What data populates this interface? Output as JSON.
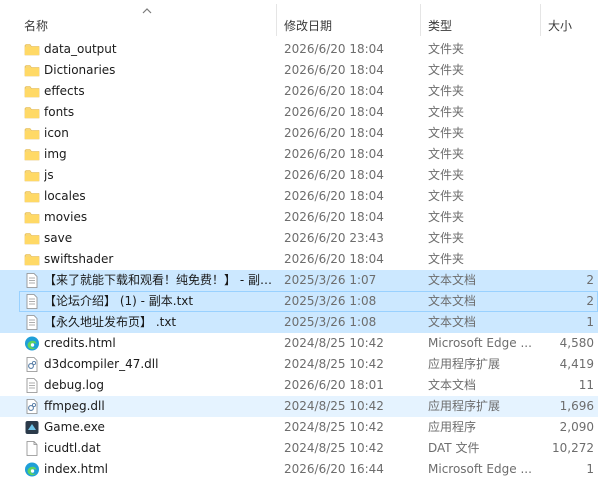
{
  "columns": {
    "name": "名称",
    "date": "修改日期",
    "type": "类型",
    "size": "大小"
  },
  "colors": {
    "selected": "#cce8ff",
    "hover": "#e5f3ff",
    "folder": "#f8d775"
  },
  "rows": [
    {
      "name": "data_output",
      "date": "2026/6/20 18:04",
      "type": "文件夹",
      "size": "",
      "icon": "folder-icon"
    },
    {
      "name": "Dictionaries",
      "date": "2026/6/20 18:04",
      "type": "文件夹",
      "size": "",
      "icon": "folder-icon"
    },
    {
      "name": "effects",
      "date": "2026/6/20 18:04",
      "type": "文件夹",
      "size": "",
      "icon": "folder-icon"
    },
    {
      "name": "fonts",
      "date": "2026/6/20 18:04",
      "type": "文件夹",
      "size": "",
      "icon": "folder-icon"
    },
    {
      "name": "icon",
      "date": "2026/6/20 18:04",
      "type": "文件夹",
      "size": "",
      "icon": "folder-icon"
    },
    {
      "name": "img",
      "date": "2026/6/20 18:04",
      "type": "文件夹",
      "size": "",
      "icon": "folder-icon"
    },
    {
      "name": "js",
      "date": "2026/6/20 18:04",
      "type": "文件夹",
      "size": "",
      "icon": "folder-icon"
    },
    {
      "name": "locales",
      "date": "2026/6/20 18:04",
      "type": "文件夹",
      "size": "",
      "icon": "folder-icon"
    },
    {
      "name": "movies",
      "date": "2026/6/20 18:04",
      "type": "文件夹",
      "size": "",
      "icon": "folder-icon"
    },
    {
      "name": "save",
      "date": "2026/6/20 23:43",
      "type": "文件夹",
      "size": "",
      "icon": "folder-icon"
    },
    {
      "name": "swiftshader",
      "date": "2026/6/20 18:04",
      "type": "文件夹",
      "size": "",
      "icon": "folder-icon"
    },
    {
      "name": "【来了就能下载和观看！纯免费！】 - 副…",
      "date": "2025/3/26 1:07",
      "type": "文本文档",
      "size": "2",
      "icon": "text-file-icon",
      "state": "sel"
    },
    {
      "name": "【论坛介绍】 (1) - 副本.txt",
      "date": "2025/3/26 1:08",
      "type": "文本文档",
      "size": "2",
      "icon": "text-file-icon",
      "state": "sel-focus"
    },
    {
      "name": "【永久地址发布页】 .txt",
      "date": "2025/3/26 1:08",
      "type": "文本文档",
      "size": "1",
      "icon": "text-file-icon",
      "state": "sel"
    },
    {
      "name": "credits.html",
      "date": "2024/8/25 10:42",
      "type": "Microsoft Edge ...",
      "size": "4,580",
      "icon": "edge-icon"
    },
    {
      "name": "d3dcompiler_47.dll",
      "date": "2024/8/25 10:42",
      "type": "应用程序扩展",
      "size": "4,419",
      "icon": "dll-icon"
    },
    {
      "name": "debug.log",
      "date": "2026/6/20 18:01",
      "type": "文本文档",
      "size": "11",
      "icon": "text-file-icon"
    },
    {
      "name": "ffmpeg.dll",
      "date": "2024/8/25 10:42",
      "type": "应用程序扩展",
      "size": "1,696",
      "icon": "dll-icon",
      "state": "hover"
    },
    {
      "name": "Game.exe",
      "date": "2024/8/25 10:42",
      "type": "应用程序",
      "size": "2,090",
      "icon": "exe-icon"
    },
    {
      "name": "icudtl.dat",
      "date": "2024/8/25 10:42",
      "type": "DAT 文件",
      "size": "10,272",
      "icon": "blank-file-icon"
    },
    {
      "name": "index.html",
      "date": "2026/6/20 16:44",
      "type": "Microsoft Edge ...",
      "size": "1",
      "icon": "edge-icon"
    }
  ]
}
